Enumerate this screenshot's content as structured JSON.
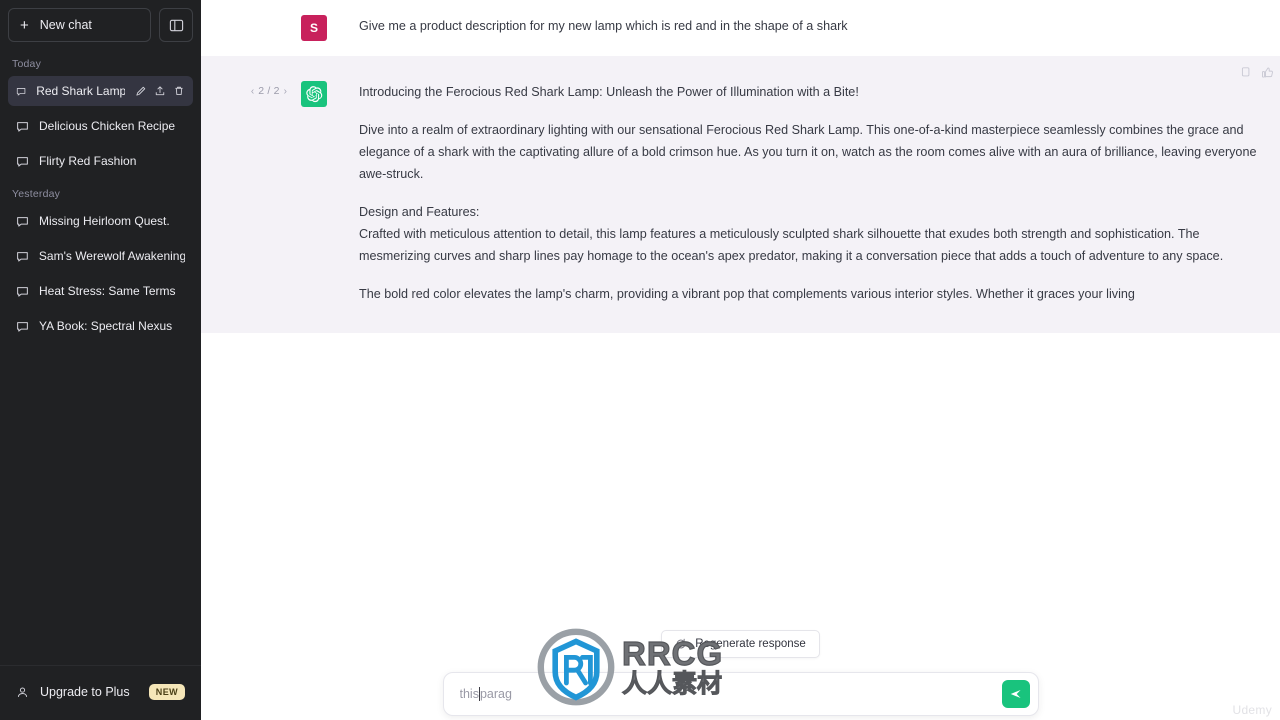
{
  "sidebar": {
    "new_chat_label": "New chat",
    "new_chat_icon": "plus-icon",
    "collapse_icon": "sidebar-collapse-icon",
    "groups": [
      {
        "label": "Today",
        "items": [
          {
            "title": "Red Shark Lamp: Inn",
            "active": true,
            "icon": "chat-bubble-icon",
            "actions": [
              "edit-icon",
              "share-icon",
              "trash-icon"
            ]
          },
          {
            "title": "Delicious Chicken Recipe",
            "active": false,
            "icon": "chat-bubble-icon"
          },
          {
            "title": "Flirty Red Fashion",
            "active": false,
            "icon": "chat-bubble-icon"
          }
        ]
      },
      {
        "label": "Yesterday",
        "items": [
          {
            "title": "Missing Heirloom Quest.",
            "active": false,
            "icon": "chat-bubble-icon"
          },
          {
            "title": "Sam's Werewolf Awakening",
            "active": false,
            "icon": "chat-bubble-icon"
          },
          {
            "title": "Heat Stress: Same Terms",
            "active": false,
            "icon": "chat-bubble-icon"
          },
          {
            "title": "YA Book: Spectral Nexus",
            "active": false,
            "icon": "chat-bubble-icon"
          }
        ]
      }
    ],
    "upgrade": {
      "label": "Upgrade to Plus",
      "badge": "NEW",
      "icon": "person-icon"
    }
  },
  "conversation": {
    "user_message": {
      "avatar_initial": "S",
      "avatar_color": "#c8215c",
      "text": "Give me a product description for my new lamp which is red and in the shape of a shark"
    },
    "assistant_message": {
      "avatar_icon": "openai-logo-icon",
      "avatar_color": "#19c37d",
      "pager": {
        "prev": "‹",
        "next": "›",
        "count": "2 / 2"
      },
      "actions": [
        "copy-icon",
        "thumbs-up-icon",
        "thumbs-down-icon"
      ],
      "heading": "Introducing the Ferocious Red Shark Lamp: Unleash the Power of Illumination with a Bite!",
      "paragraphs": [
        "Dive into a realm of extraordinary lighting with our sensational Ferocious Red Shark Lamp. This one-of-a-kind masterpiece seamlessly combines the grace and elegance of a shark with the captivating allure of a bold crimson hue. As you turn it on, watch as the room comes alive with an aura of brilliance, leaving everyone awe-struck.",
        "Design and Features:",
        "Crafted with meticulous attention to detail, this lamp features a meticulously sculpted shark silhouette that exudes both strength and sophistication. The mesmerizing curves and sharp lines pay homage to the ocean's apex predator, making it a conversation piece that adds a touch of adventure to any space.",
        "The bold red color elevates the lamp's charm, providing a vibrant pop that complements various interior styles. Whether it graces your living"
      ]
    }
  },
  "composer": {
    "regenerate_label": "Regenerate response",
    "regenerate_icon": "refresh-icon",
    "input_text_before_caret": "this",
    "input_text_after_caret": "parag",
    "send_icon": "send-icon",
    "send_color": "#19c37d"
  },
  "watermarks": {
    "brand_top": "RRCG",
    "brand_bottom": "人人素材",
    "corner": "Udemy"
  }
}
